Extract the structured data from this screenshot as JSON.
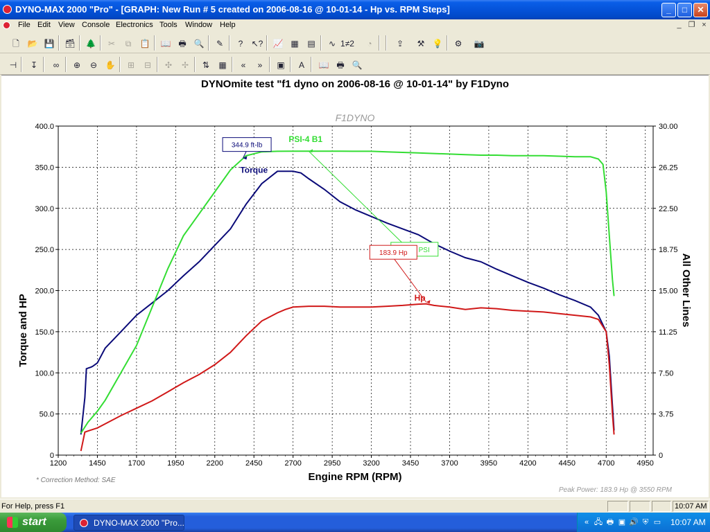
{
  "window": {
    "title": "DYNO-MAX 2000 \"Pro\" - [GRAPH: New Run # 5 created on 2006-08-16 @ 10-01-14 - Hp vs. RPM Steps]",
    "buttons": {
      "minimize": "_",
      "maximize": "□",
      "close": "✕"
    }
  },
  "menu": [
    "File",
    "Edit",
    "View",
    "Console",
    "Electronics",
    "Tools",
    "Window",
    "Help"
  ],
  "mdi_buttons": {
    "minimize": "_",
    "restore": "❐",
    "close": "×"
  },
  "toolbar1_icons": [
    {
      "name": "new-icon",
      "glyph": "🗋"
    },
    {
      "name": "open-icon",
      "glyph": "📂"
    },
    {
      "name": "save-icon",
      "glyph": "💾"
    },
    {
      "name": "briefcase-icon",
      "glyph": "🗃"
    },
    {
      "name": "tree-icon",
      "glyph": "🌲"
    },
    {
      "name": "cut-icon",
      "glyph": "✂"
    },
    {
      "name": "copy-icon",
      "glyph": "⧉"
    },
    {
      "name": "paste-icon",
      "glyph": "📋"
    },
    {
      "name": "book-icon",
      "glyph": "📖"
    },
    {
      "name": "print-icon",
      "glyph": "🖶"
    },
    {
      "name": "print-preview-icon",
      "glyph": "🔍"
    },
    {
      "name": "wizard-icon",
      "glyph": "✎"
    },
    {
      "name": "help-icon",
      "glyph": "?"
    },
    {
      "name": "context-help-icon",
      "glyph": "↖?"
    },
    {
      "name": "graph-icon",
      "glyph": "📈"
    },
    {
      "name": "grid-icon",
      "glyph": "▦"
    },
    {
      "name": "table-icon",
      "glyph": "▤"
    },
    {
      "name": "wave-icon",
      "glyph": "∿"
    },
    {
      "name": "step-icon",
      "glyph": "1≠2"
    },
    {
      "name": "gauge-icon",
      "glyph": "◔"
    },
    {
      "name": "export-icon",
      "glyph": "⇪"
    },
    {
      "name": "tools-icon",
      "glyph": "⚒"
    },
    {
      "name": "bulb-icon",
      "glyph": "💡"
    },
    {
      "name": "settings-icon",
      "glyph": "⚙"
    },
    {
      "name": "camera-icon",
      "glyph": "📷"
    }
  ],
  "toolbar2_icons": [
    {
      "name": "pin-icon",
      "glyph": "⊣"
    },
    {
      "name": "marker-icon",
      "glyph": "↧"
    },
    {
      "name": "overlay-icon",
      "glyph": "∞"
    },
    {
      "name": "zoom-in-icon",
      "glyph": "⊕"
    },
    {
      "name": "zoom-out-icon",
      "glyph": "⊖"
    },
    {
      "name": "pan-hand-icon",
      "glyph": "✋"
    },
    {
      "name": "stamp-icon",
      "glyph": "⊞"
    },
    {
      "name": "stamp2-icon",
      "glyph": "⊟"
    },
    {
      "name": "cursor-icon",
      "glyph": "✣"
    },
    {
      "name": "cursor2-icon",
      "glyph": "✢"
    },
    {
      "name": "scale-icon",
      "glyph": "⇅"
    },
    {
      "name": "grid-table-icon",
      "glyph": "▦"
    },
    {
      "name": "prev-icon",
      "glyph": "«"
    },
    {
      "name": "next-icon",
      "glyph": "»"
    },
    {
      "name": "graph-window-icon",
      "glyph": "▣"
    },
    {
      "name": "text-icon",
      "glyph": "A"
    },
    {
      "name": "book2-icon",
      "glyph": "📖"
    },
    {
      "name": "print2-icon",
      "glyph": "🖶"
    },
    {
      "name": "preview2-icon",
      "glyph": "🔍"
    }
  ],
  "graph": {
    "title": "DYNOmite test \"f1 dyno on 2006-08-16 @ 10-01-14\" by F1Dyno",
    "watermark": "F1DYNO",
    "correction": "* Correction Method: SAE",
    "peak_power": "Peak Power: 183.9 Hp @ 3550 RPM"
  },
  "chart_data": {
    "type": "line",
    "xlabel": "Engine RPM (RPM)",
    "ylabel": "Torque and HP",
    "y2label": "All Other Lines",
    "xlim": [
      1200,
      5000
    ],
    "ylim": [
      0,
      400
    ],
    "y2lim": [
      0,
      30
    ],
    "grid": true,
    "x_ticks": [
      "1200",
      "1450",
      "1700",
      "1950",
      "2200",
      "2450",
      "2700",
      "2950",
      "3200",
      "3450",
      "3700",
      "3950",
      "4200",
      "4450",
      "4700",
      "4950"
    ],
    "y_ticks": [
      "0",
      "50.0",
      "100.0",
      "150.0",
      "200.0",
      "250.0",
      "300.0",
      "350.0",
      "400.0"
    ],
    "y2_ticks": [
      "0",
      "3.75",
      "7.50",
      "11.25",
      "15.00",
      "18.75",
      "22.50",
      "26.25",
      "30.00"
    ],
    "series": [
      {
        "name": "Torque",
        "axis": "left",
        "color": "#0A0A78",
        "x": [
          1345,
          1370,
          1380,
          1410,
          1420,
          1450,
          1500,
          1600,
          1700,
          1800,
          1900,
          2000,
          2100,
          2200,
          2300,
          2400,
          2500,
          2600,
          2650,
          2700,
          2750,
          2800,
          2900,
          3000,
          3100,
          3200,
          3300,
          3400,
          3500,
          3600,
          3700,
          3800,
          3900,
          4000,
          4100,
          4200,
          4300,
          4400,
          4500,
          4600,
          4650,
          4700,
          4720,
          4740,
          4750
        ],
        "y": [
          25,
          70,
          105,
          107,
          108,
          112,
          130,
          150,
          170,
          185,
          200,
          218,
          235,
          255,
          275,
          305,
          330,
          345,
          345,
          345,
          343,
          336,
          323,
          308,
          298,
          290,
          282,
          275,
          268,
          257,
          248,
          240,
          235,
          226,
          218,
          210,
          203,
          195,
          188,
          180,
          170,
          150,
          120,
          60,
          30
        ]
      },
      {
        "name": "PSI-4 B1",
        "axis": "right",
        "color": "#33DD33",
        "x": [
          1345,
          1390,
          1450,
          1500,
          1600,
          1700,
          1800,
          1900,
          2000,
          2100,
          2200,
          2300,
          2400,
          2500,
          2600,
          2700,
          2800,
          2900,
          3000,
          3100,
          3200,
          3300,
          3400,
          3500,
          3600,
          3700,
          3800,
          3900,
          4000,
          4100,
          4200,
          4300,
          4400,
          4500,
          4600,
          4650,
          4680,
          4700,
          4720,
          4740,
          4750
        ],
        "y": [
          2.0,
          3.0,
          4.0,
          5.0,
          7.5,
          10.0,
          13.5,
          17.0,
          20.0,
          22.0,
          24.0,
          26.0,
          27.3,
          27.65,
          27.7,
          27.71,
          27.71,
          27.71,
          27.71,
          27.7,
          27.7,
          27.65,
          27.6,
          27.55,
          27.5,
          27.45,
          27.4,
          27.35,
          27.35,
          27.3,
          27.3,
          27.3,
          27.25,
          27.2,
          27.2,
          27.0,
          26.5,
          24.0,
          20.0,
          16.0,
          14.5
        ]
      },
      {
        "name": "Hp",
        "axis": "left",
        "color": "#D01818",
        "x": [
          1345,
          1370,
          1400,
          1450,
          1500,
          1600,
          1700,
          1800,
          1900,
          2000,
          2100,
          2200,
          2300,
          2400,
          2500,
          2600,
          2650,
          2700,
          2800,
          2900,
          3000,
          3100,
          3200,
          3300,
          3400,
          3500,
          3550,
          3600,
          3700,
          3800,
          3900,
          4000,
          4100,
          4200,
          4300,
          4400,
          4500,
          4600,
          4650,
          4700,
          4720,
          4740,
          4750
        ],
        "y": [
          5,
          28,
          30,
          33,
          38,
          48,
          57,
          66,
          77,
          88,
          98,
          110,
          125,
          145,
          163,
          173,
          177,
          180,
          181,
          181,
          180,
          180,
          180,
          181,
          182,
          183.5,
          183.9,
          182,
          180,
          177,
          179,
          178,
          176,
          175,
          174,
          172,
          170,
          168,
          165,
          150,
          110,
          50,
          25
        ]
      }
    ],
    "annotations": [
      {
        "text": "344.9 ft-lb",
        "color": "#0A0A78",
        "x": 2700,
        "y": 344.9,
        "axis": "left"
      },
      {
        "text": "27.71 PSI",
        "color": "#33DD33",
        "x": 2800,
        "y": 27.71,
        "axis": "right"
      },
      {
        "text": "183.9 Hp",
        "color": "#D01818",
        "x": 3550,
        "y": 183.9,
        "axis": "left"
      }
    ]
  },
  "status": {
    "help": "For Help, press F1",
    "time": "10:07 AM"
  },
  "taskbar": {
    "start": "start",
    "item": "DYNO-MAX 2000 \"Pro...",
    "clock": "10:07 AM"
  },
  "tray_icons": [
    {
      "name": "arrow-icon",
      "glyph": "«"
    },
    {
      "name": "network-icon",
      "glyph": "🖧"
    },
    {
      "name": "printer-tray-icon",
      "glyph": "🖶"
    },
    {
      "name": "monitor-icon",
      "glyph": "▣"
    },
    {
      "name": "volume-icon",
      "glyph": "🔊"
    },
    {
      "name": "security-icon",
      "glyph": "⛨"
    },
    {
      "name": "battery-icon",
      "glyph": "▭"
    }
  ]
}
